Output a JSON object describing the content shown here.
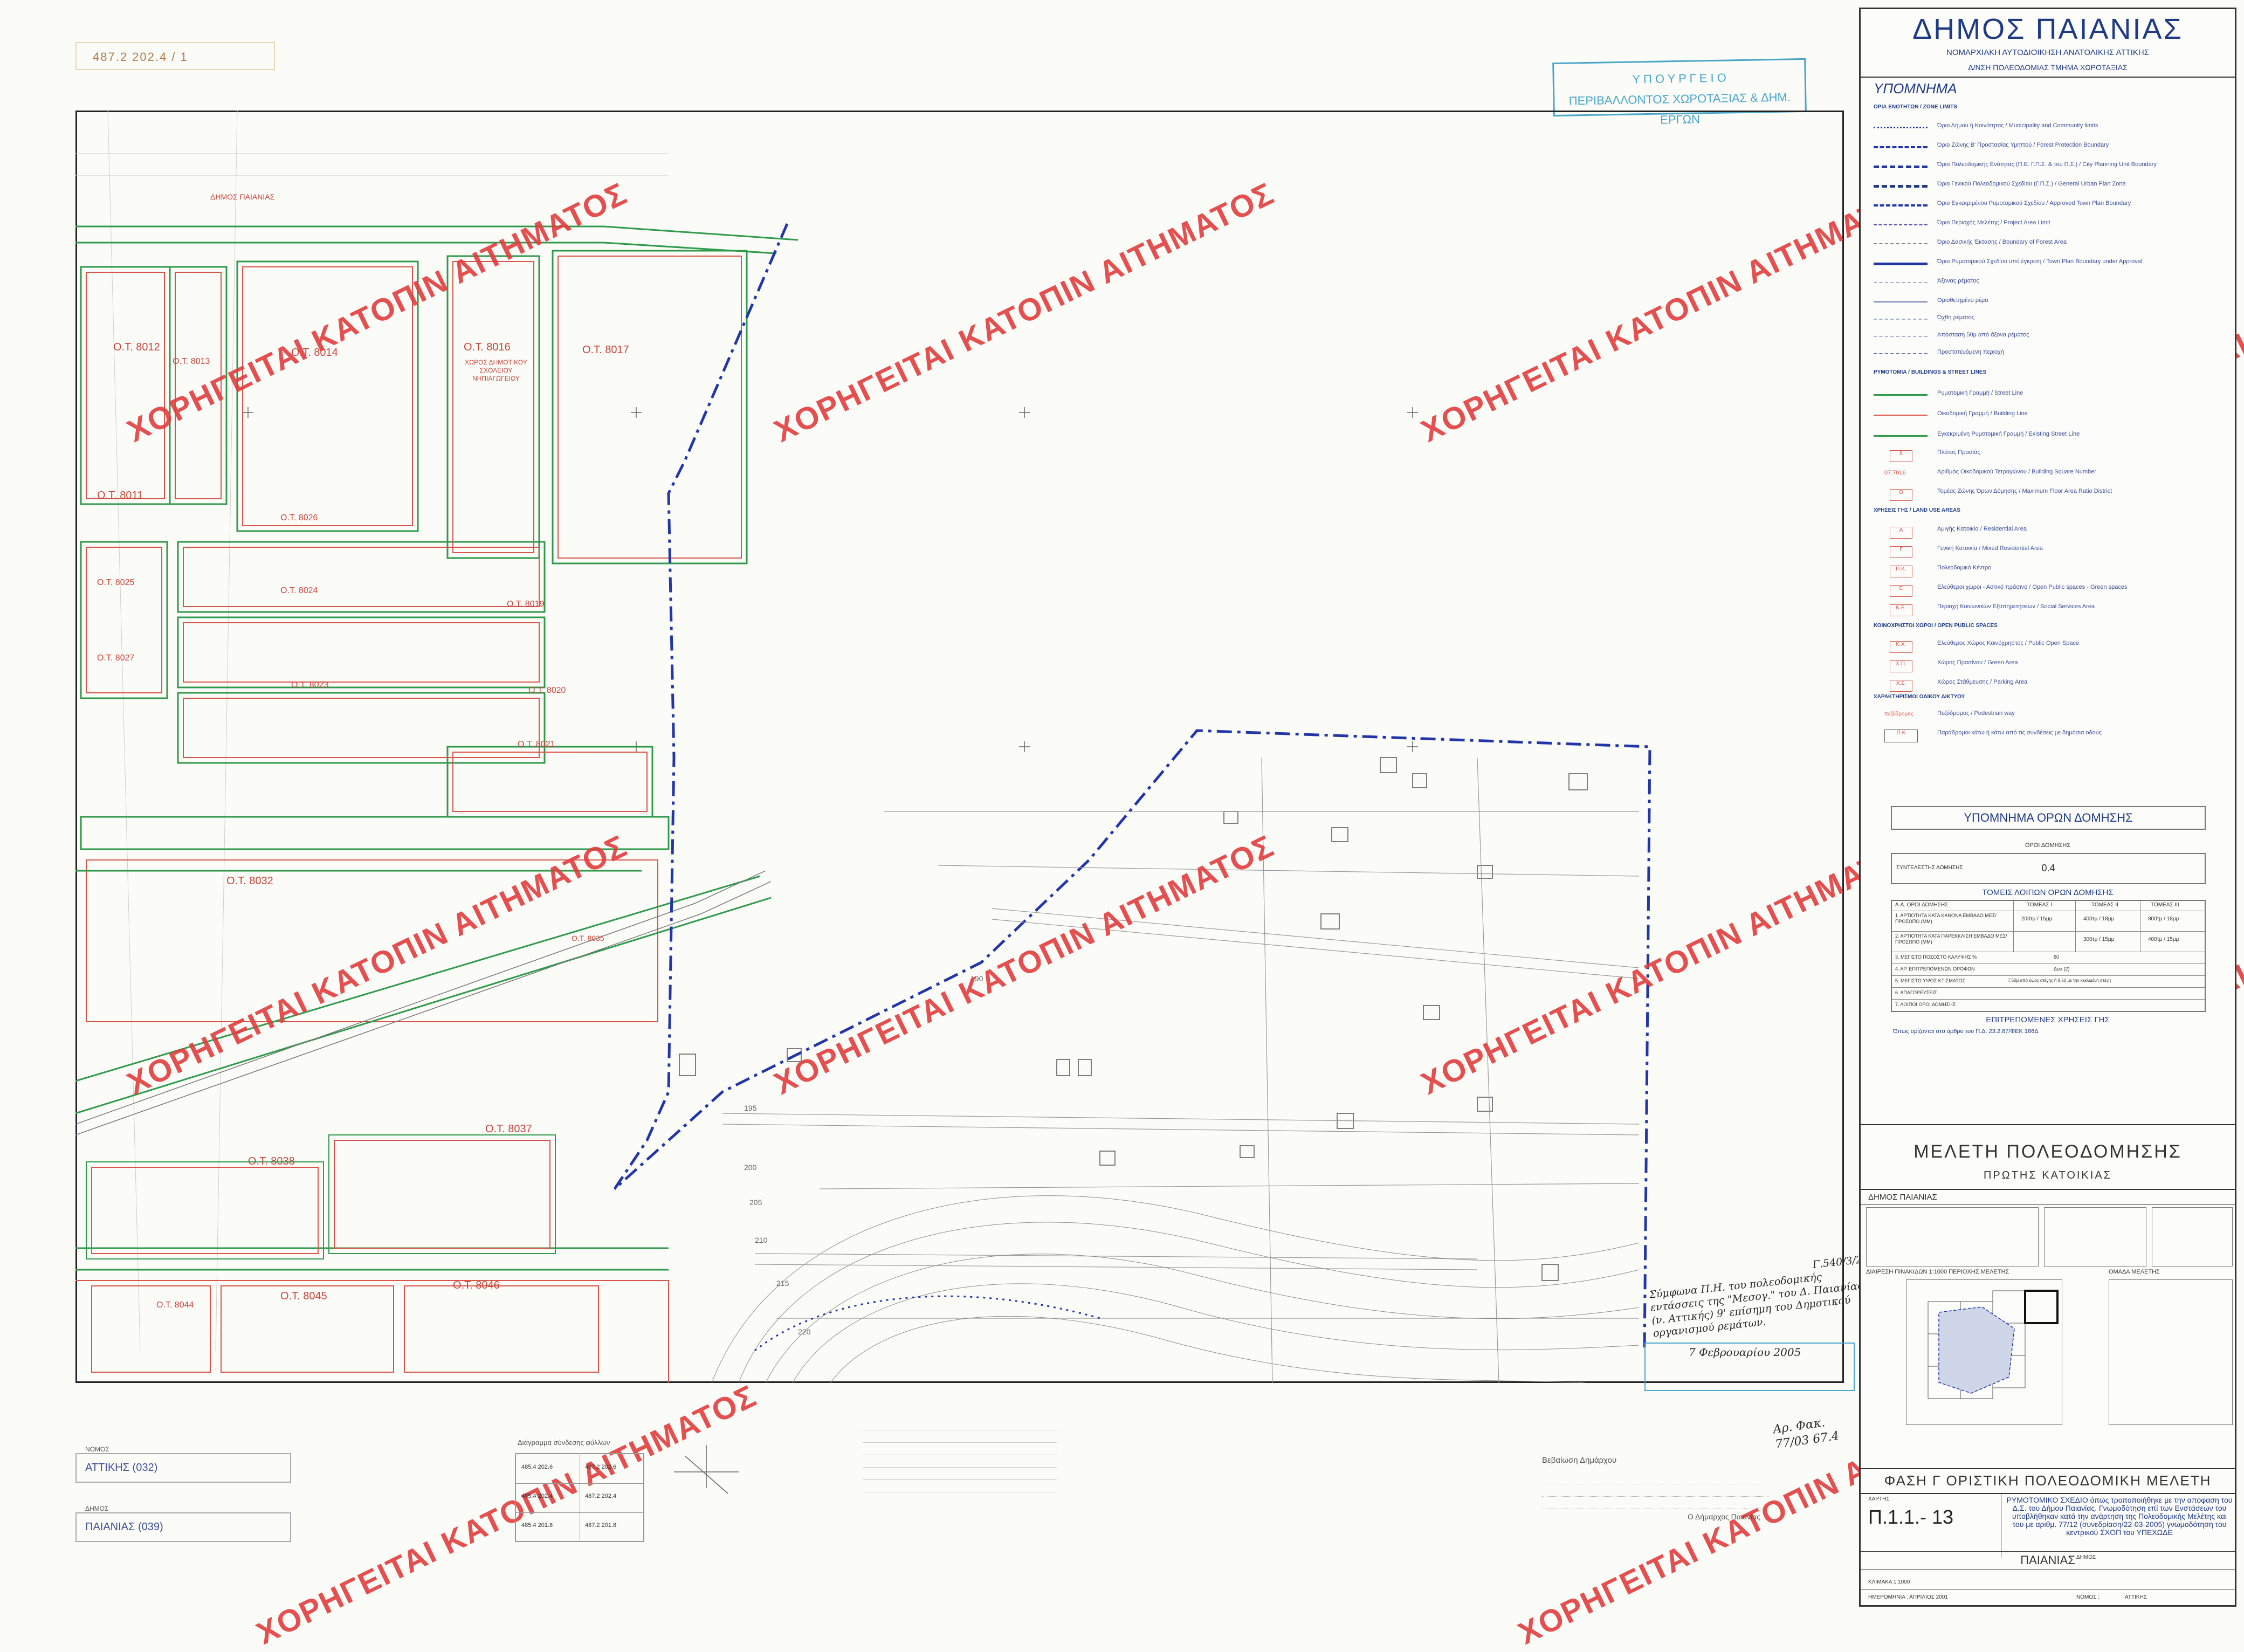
{
  "sheet": {
    "numbers": "487.2    202.4   /   1"
  },
  "stamp": {
    "line1": "Υ Π Ο Υ Ρ Γ Ε Ι Ο",
    "line2": "ΠΕΡΙΒΑΛΛΟΝΤΟΣ ΧΩΡΟΤΑΞΙΑΣ & ΔΗΜ. ΕΡΓΩΝ"
  },
  "watermark": "ΧΟΡΗΓΕΙΤΑΙ ΚΑΤΟΠΙΝ ΑΙΤΗΜΑΤΟΣ",
  "map": {
    "blocks": [
      "Ο.Τ. 8012",
      "Ο.Τ. 8013",
      "Ο.Τ. 8014",
      "Ο.Τ. 8016",
      "Ο.Τ. 8017",
      "Ο.Τ. 8011",
      "Ο.Τ. 8025",
      "Ο.Τ. 8026",
      "Ο.Τ. 8024",
      "Ο.Τ. 8019",
      "Ο.Τ. 8027",
      "Ο.Τ. 8023",
      "Ο.Τ. 8020",
      "Ο.Τ. 8021",
      "Ο.Τ. 8032",
      "Ο.Τ. 8035",
      "Ο.Τ. 8037",
      "Ο.Τ. 8038",
      "Ο.Τ. 8044",
      "Ο.Τ. 8045",
      "Ο.Τ. 8046"
    ],
    "block8016_note": "ΧΩΡΟΣ ΔΗΜΟΤΙΚΟΥ ΣΧΟΛΕΙΟΥ ΝΗΠΙΑΓΩΓΕΙΟΥ",
    "municipality_label": "ΔΗΜΟΣ ΠΑΙΑΝΙΑΣ",
    "contours": [
      "190",
      "195",
      "200",
      "205",
      "210",
      "215",
      "220"
    ]
  },
  "panel": {
    "title": "ΔΗΜΟΣ ΠΑΙΑΝΙΑΣ",
    "subtitle": "ΝΟΜΑΡΧΙΑΚΗ ΑΥΤΟΔΙΟΙΚΗΣΗ ΑΝΑΤΟΛΙΚΗΣ ΑΤΤΙΚΗΣ",
    "dept": "Δ/ΝΣΗ ΠΟΛΕΟΔΟΜΙΑΣ      ΤΜΗΜΑ ΧΩΡΟΤΑΞΙΑΣ",
    "legend_title": "ΥΠΟΜΝΗΜΑ",
    "legend_sections": [
      "ΟΡΙΑ ΕΝΟΤΗΤΩΝ / ZONE LIMITS",
      "ΡΥΜΟΤΟΜΙΑ / BUILDINGS & STREET LINES",
      "ΧΡΗΣΕΙΣ ΓΗΣ / LAND USE AREAS",
      "ΚΟΙΝΟΧΡΗΣΤΟΙ ΧΩΡΟΙ / OPEN PUBLIC SPACES",
      "ΧΑΡΑΚΤΗΡΙΣΜΟΙ ΟΔΙΚΟΥ ΔΙΚΤΥΟΥ"
    ],
    "legend_items": [
      "Όριο Δήμου ή Κοινότητας / Municipality and Community limits",
      "Όριο Ζώνης Β' Προστασίας Υμηττού / Forest Protection Boundary",
      "Όριο Πολεοδομικής Ενότητας (Π.Ε. Γ.Π.Σ. & του Π.Σ.) / City Planning Unit Boundary",
      "Όριο Γενικού Πολεοδομικού Σχεδίου (Γ.Π.Σ.) / General Urban Plan Zone",
      "Όριο Εγκεκριμένου Ρυμοτομικού Σχεδίου / Approved Town Plan Boundary",
      "Όριο Περιοχής Μελέτης / Project Area Limit",
      "Όριο Δασικής Έκτασης / Boundary of Forest Area",
      "Όριο Ρυμοτομικού Σχεδίου υπό έγκριση / Town Plan Boundary under Approval",
      "Άξονας ρέματος",
      "Οριοθετημένο ρέμα",
      "Όχθη ρέματος",
      "Απόσταση 50μ από άξονα ρέματος",
      "Προστατευόμενη περιοχή",
      "Ρυμοτομική Γραμμή / Street Line",
      "Οικοδομική Γραμμή / Building Line",
      "Εγκεκριμένη Ρυμοτομική Γραμμή / Existing Street Line",
      "Πλάτος Πρασιάς",
      "Αριθμός Οικοδομικού Τετραγώνου / Building Square Number",
      "Τομέας Ζώνης Όρων Δόμησης / Maximum Floor Area Ratio District",
      "Αμιγής Κατοικία / Residential Area",
      "Γενική Κατοικία / Mixed Residential Area",
      "Πολεοδομικό Κέντρο",
      "Ελεύθεροι χώροι - Αστικό πράσινο / Open Public spaces - Green spaces",
      "Περιοχή Κοινωνικών Εξυπηρετήσεων / Social Services Area",
      "Ελεύθερος Χώρος Κοινόχρηστος / Public Open Space",
      "Χώρος Πρασίνου / Green Area",
      "Χώρος Στάθμευσης / Parking Area",
      "Πεζόδρομος / Pedestrian way",
      "Παράδρομοι κάτω ή κάτω από τις συνδέσεις με δημόσια οδούς"
    ],
    "legend_codes": [
      "8",
      "07.7016",
      "Θ",
      "Α",
      "Γ",
      "Π.Κ.",
      "Ε",
      "Κ.Ε.",
      "Κ.Χ.",
      "Χ.Π.",
      "Χ.Σ.",
      "πεζόδρομος",
      "Π.Κ"
    ],
    "building_title": "ΥΠΟΜΝΗΜΑ ΟΡΩΝ ΔΟΜΗΣΗΣ",
    "building_sub": "ΟΡΟΙ ΔΟΜΗΣΗΣ",
    "ratio_label": "ΣΥΝΤΕΛΕΣΤΗΣ ΔΟΜΗΣΗΣ",
    "ratio_value": "0.4",
    "sectors_title": "ΤΟΜΕΙΣ ΛΟΙΠΩΝ ΟΡΩΝ ΔΟΜΗΣΗΣ",
    "sector_cols": [
      "Α.Α. ΟΡΟΙ ΔΟΜΗΣΗΣ",
      "ΤΟΜΕΑΣ Ι",
      "ΤΟΜΕΑΣ ΙΙ",
      "ΤΟΜΕΑΣ ΙΙΙ"
    ],
    "sector_rows": [
      [
        "1. ΑΡΤΙΟΤΗΤΑ ΚΑΤΑ ΚΑΝΟΝΑ ΕΜΒΑΔΟ ΜΕΣ/ΠΡΟΣΩΠΟ (ΜΜ)",
        "200τμ / 15μμ",
        "400τμ / 18μμ",
        "800τμ / 18μμ"
      ],
      [
        "2. ΑΡΤΙΟΤΗΤΑ ΚΑΤΑ ΠΑΡΕΚΚΛΙΣΗ ΕΜΒΑΔΟ ΜΕΣ/ΠΡΟΣΩΠΟ (ΜΜ)",
        "",
        "300τμ / 15μμ",
        "400τμ / 15μμ"
      ],
      [
        "3. ΜΕΓΙΣΤΟ ΠΟΣΟΣΤΟ ΚΑΛΥΨΗΣ %",
        "60",
        "",
        ""
      ],
      [
        "4. ΑΡ. ΕΠΙΤΡΕΠΟΜΕΝΩΝ ΟΡΟΦΩΝ",
        "Δύο (2)",
        "",
        ""
      ],
      [
        "5. ΜΕΓΙΣΤΟ ΥΨΟΣ ΚΤΙΣΜΑΤΟΣ",
        "7,50μ από ύψος στέγης ή 8,50 με την κεκλιμένη στέγη",
        "",
        ""
      ],
      [
        "6. ΑΠΑΓΟΡΕΥΣΕΙΣ",
        "",
        "",
        ""
      ],
      [
        "7. ΛΟΙΠΟΙ ΟΡΟΙ ΔΟΜΗΣΗΣ",
        "",
        "",
        ""
      ]
    ],
    "uses_title": "ΕΠΙΤΡΕΠΟΜΕΝΕΣ ΧΡΗΣΕΙΣ ΓΗΣ",
    "uses_text": "Όπως ορίζονται στο άρθρο του Π.Δ. 23.2.87/ΦΕΚ 166Δ",
    "study_title": "ΜΕΛΕΤΗ   ΠΟΛΕΟΔΟΜΗΣΗΣ",
    "study_sub": "ΠΡΩΤΗΣ   ΚΑΤΟΙΚΙΑΣ",
    "study_municipality": "ΔΗΜΟΣ ΠΑΙΑΝΙΑΣ",
    "sheets_title": "ΔΙΑΙΡΕΣΗ ΠΙΝΑΚΙΔΩΝ 1:1000 ΠΕΡΙΟΧΗΣ ΜΕΛΕΤΗΣ",
    "team_title": "ΟΜΑΔΑ ΜΕΛΕΤΗΣ",
    "phase": "ΦΑΣΗ Γ  ΟΡΙΣΤΙΚΗ ΠΟΛΕΟΔΟΜΙΚΗ ΜΕΛΕΤΗ",
    "map_label": "ΧΑΡΤΗΣ",
    "map_code": "Π.1.1.- 13",
    "approval_text": "ΡΥΜΟΤΟΜΙΚΟ ΣΧΕΔΙΟ όπως τροποποιήθηκε με την απόφαση του Δ.Σ. του Δήμου Παιανίας. Γνωμοδότηση επί των Ενστάσεων του υποβλήθηκαν κατά την ανάρτηση της Πολεοδομικής Μελέτης και του με αριθμ. 77/12 (συνεδρίαση/22-03-2005) γνωμοδότηση του κεντρικού ΣΧΟΠ του ΥΠΕΧΩΔΕ",
    "dimos_label": "ΔΗΜΟΣ",
    "dimos_value": "ΠΑΙΑΝΙΑΣ",
    "scale": "ΚΛΙΜΑΚΑ 1:1000",
    "date": "ΗΜΕΡΟΜΗΝΙΑ : ΑΠΡΙΛΙΟΣ 2001",
    "nomos_label": "ΝΟΜΟΣ :",
    "nomos_value": "ΑΤΤΙΚΗΣ"
  },
  "bottom": {
    "nomos_label": "ΝΟΜΟΣ",
    "nomos_value": "ΑΤΤΙΚΗΣ (032)",
    "dimos_label": "ΔΗΜΟΣ",
    "dimos_value": "ΠΑΙΑΝΙΑΣ (039)",
    "grid_title": "Διάγραμμα σύνδεσης φύλλων",
    "grid_cells": [
      "485.4  202.6",
      "487.2  202.6",
      "485.4  202.4",
      "487.2  202.4",
      "485.4  201.8",
      "487.2  201.8"
    ],
    "certify_title": "Βεβαίωση Δημάρχου",
    "certify_sign": "Ο Δήμαρχος Παιανίας",
    "hand_note": "Σύμφωνα Π.Η. του πολεοδομικής εντάσσεις της \"Μεσογ.\" του Δ. Παιανίας (ν. Αττικής) 9' επίσημη του Δημοτικού οργανισμού ρεμάτων.",
    "hand_date": "7 Φεβρουαρίου 2005",
    "hand_ref": "Αρ. Φακ. 77/03   67.4",
    "hand_code": "Γ.540/3/2"
  }
}
